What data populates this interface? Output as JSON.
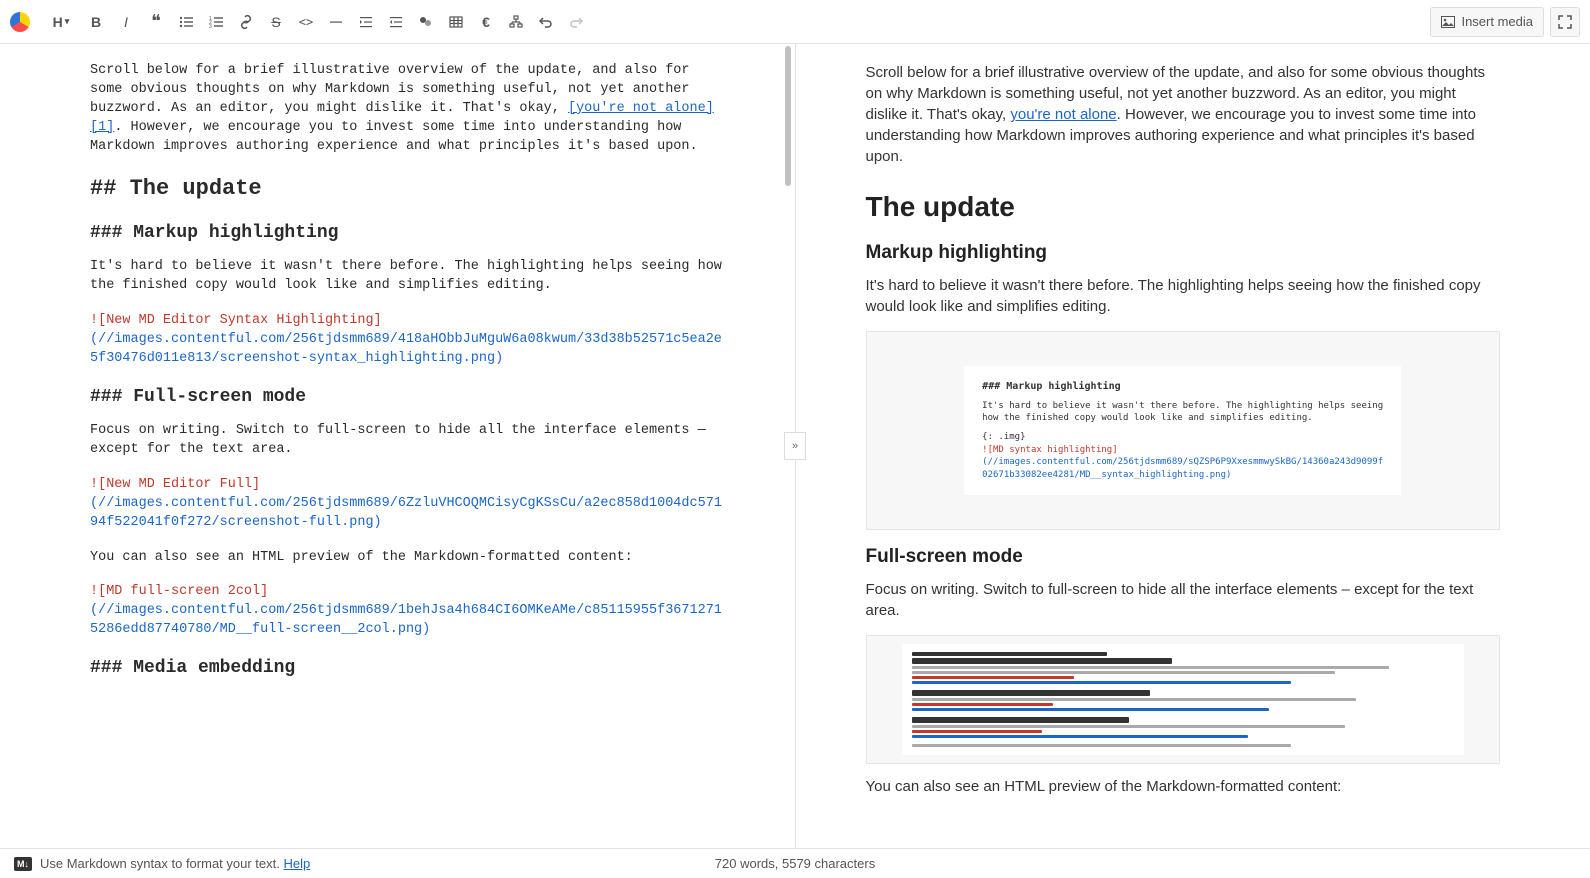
{
  "toolbar": {
    "heading_label": "H",
    "insert_media_label": "Insert media"
  },
  "editor": {
    "intro_before_link": "Scroll below for a brief illustrative overview of the update, and also for some obvious thoughts on why Markdown is something useful, not yet another buzzword. As an editor, you might dislike it. That's okay, ",
    "intro_link": "[you're not alone][1]",
    "intro_after_link": ". However, we encourage you to invest some time into understanding how Markdown improves authoring experience and what principles it's based upon.",
    "h2_update": "## The update",
    "h3_highlight": "### Markup highlighting",
    "p_highlight": "It's hard to believe it wasn't there before. The highlighting helps seeing how the finished copy would look like and simplifies editing.",
    "img1_alt": "![New MD Editor Syntax Highlighting]",
    "img1_url": "(//images.contentful.com/256tjdsmm689/418aHObbJuMguW6a08kwum/33d38b52571c5ea2e5f30476d011e813/screenshot-syntax_highlighting.png)",
    "h3_fullscreen": "### Full-screen mode",
    "p_fullscreen": "Focus on writing. Switch to full-screen to hide all the interface elements — except for the text area.",
    "img2_alt": "![New MD Editor Full]",
    "img2_url": "(//images.contentful.com/256tjdsmm689/6ZzluVHCOQMCisyCgKSsCu/a2ec858d1004dc57194f522041f0f272/screenshot-full.png)",
    "p_htmlpreview": "You can also see an HTML preview of the Markdown-formatted content:",
    "img3_alt": "![MD  full-screen  2col]",
    "img3_url": "(//images.contentful.com/256tjdsmm689/1behJsa4h684CI6OMKeAMe/c85115955f36712715286edd87740780/MD__full-screen__2col.png)",
    "h3_media": "### Media embedding"
  },
  "preview": {
    "intro_before_link": "Scroll below for a brief illustrative overview of the update, and also for some obvious thoughts on why Markdown is something useful, not yet another buzzword. As an editor, you might dislike it. That's okay, ",
    "intro_link": "you're not alone",
    "intro_after_link": ". However, we encourage you to invest some time into understanding how Markdown improves authoring experience and what principles it's based upon.",
    "h2_update": "The update",
    "h3_highlight": "Markup highlighting",
    "p_highlight": "It's hard to believe it wasn't there before. The highlighting helps seeing how the finished copy would look like and simplifies editing.",
    "h3_fullscreen": "Full-screen mode",
    "p_fullscreen": "Focus on writing. Switch to full-screen to hide all the interface elements – except for the text area.",
    "p_htmlpreview": "You can also see an HTML preview of the Markdown-formatted content:"
  },
  "fakeimg1": {
    "h": "### Markup highlighting",
    "p": "It's hard to believe it wasn't there before. The highlighting helps seeing how the finished copy would look like and simplifies editing.",
    "g": "{: .img}",
    "alt": "![MD  syntax highlighting]",
    "url": "(//images.contentful.com/256tjdsmm689/sQZSP6P9XxesmmwySkBG/14360a243d9099f02671b33082ee4281/MD__syntax_highlighting.png)"
  },
  "statusbar": {
    "help_text": "Use Markdown syntax to format your text. ",
    "help_link": "Help",
    "counts": "720 words, 5579 characters"
  }
}
